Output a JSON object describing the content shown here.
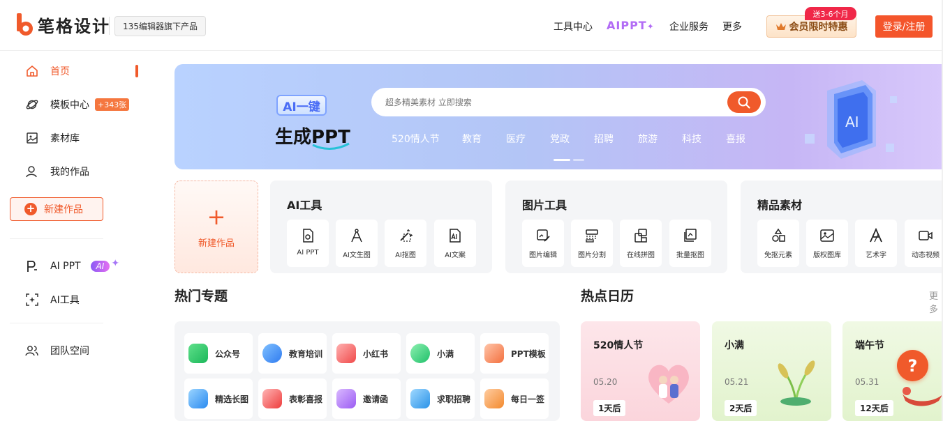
{
  "brand": {
    "name": "笔格设计",
    "sub": "135编辑器旗下产品",
    "accent": "#f05a2b"
  },
  "nav": {
    "tools": "工具中心",
    "aippt": "AIPPT",
    "enterprise": "企业服务",
    "more": "更多",
    "member": "会员限时特惠",
    "member_tag": "送3-6个月",
    "login": "登录/注册"
  },
  "sidebar": {
    "items": [
      {
        "label": "首页",
        "icon": "home-icon"
      },
      {
        "label": "模板中心",
        "icon": "planet-icon",
        "badge": "+343张"
      },
      {
        "label": "素材库",
        "icon": "image-icon"
      },
      {
        "label": "我的作品",
        "icon": "user-icon"
      }
    ],
    "new_work": "新建作品",
    "ai_ppt": "AI PPT",
    "ai_badge": "AI",
    "ai_tools": "AI工具",
    "team": "团队空间"
  },
  "banner": {
    "badge": "AI一键",
    "title": "生成PPT",
    "search_placeholder": "超多精美素材 立即搜索",
    "tags": [
      "520情人节",
      "教育",
      "医疗",
      "党政",
      "招聘",
      "旅游",
      "科技",
      "喜报"
    ],
    "cube_label": "AI"
  },
  "create": {
    "label": "新建作品"
  },
  "tool_groups": [
    {
      "title": "AI工具",
      "tools": [
        "AI PPT",
        "AI文生图",
        "AI抠图",
        "AI文案"
      ]
    },
    {
      "title": "图片工具",
      "tools": [
        "图片编辑",
        "图片分割",
        "在线拼图",
        "批量抠图"
      ]
    },
    {
      "title": "精品素材",
      "tools": [
        "免抠元素",
        "版权图库",
        "艺术字",
        "动态视频"
      ]
    }
  ],
  "hot": {
    "title": "热门专题",
    "topics": [
      "公众号",
      "教育培训",
      "小红书",
      "小满",
      "PPT模板",
      "精选长图",
      "表彰喜报",
      "邀请函",
      "求职招聘",
      "每日一签"
    ]
  },
  "calendar": {
    "title": "热点日历",
    "more": "更多",
    "items": [
      {
        "name": "520情人节",
        "date": "05.20",
        "days": "1天后"
      },
      {
        "name": "小满",
        "date": "05.21",
        "days": "2天后"
      },
      {
        "name": "端午节",
        "date": "05.31",
        "days": "12天后"
      }
    ]
  },
  "help": "?"
}
